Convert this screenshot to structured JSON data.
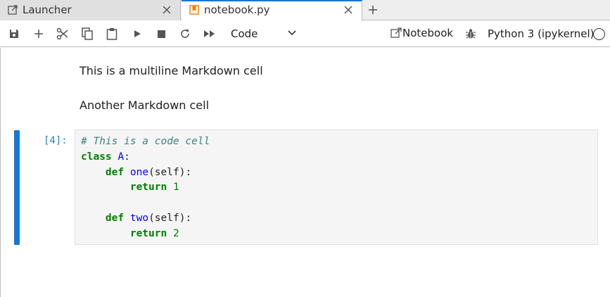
{
  "tabs": [
    {
      "label": "Launcher",
      "icon": "launcher-icon",
      "active": false
    },
    {
      "label": "notebook.py",
      "icon": "notebook-file-icon",
      "active": true
    }
  ],
  "toolbar": {
    "cell_type": "Code",
    "notebook_link": "Notebook",
    "kernel": "Python 3 (ipykernel)"
  },
  "cells": {
    "markdown1": "This is a multiline Markdown cell",
    "markdown2": "Another Markdown cell",
    "code_prompt": "[4]:",
    "code_lines": {
      "line1_comment": "# This is a code cell",
      "line2_kw": "class",
      "line2_name": "A",
      "line2_rest": ":",
      "line3_kw": "def",
      "line3_name": "one",
      "line3_rest": "(self):",
      "line4_kw": "return",
      "line4_num": "1",
      "line6_kw": "def",
      "line6_name": "two",
      "line6_rest": "(self):",
      "line7_kw": "return",
      "line7_num": "2"
    }
  },
  "colors": {
    "accent": "#1976d2",
    "notebook_icon": "#f57c00",
    "prompt": "#307fc1"
  }
}
